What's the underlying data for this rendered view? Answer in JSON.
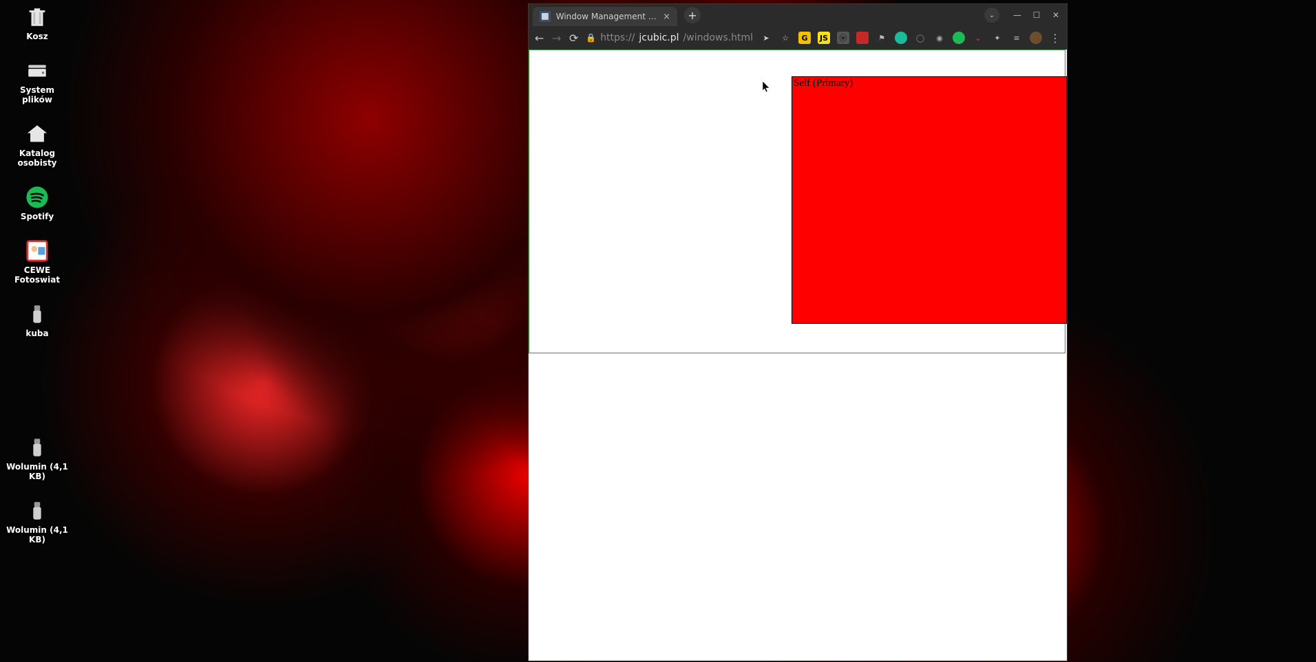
{
  "desktop": {
    "icons": [
      {
        "id": "trash",
        "label": "Kosz"
      },
      {
        "id": "files",
        "label": "System plików"
      },
      {
        "id": "home",
        "label": "Katalog osobisty"
      },
      {
        "id": "spotify",
        "label": "Spotify"
      },
      {
        "id": "cewe",
        "label": "CEWE Fotoswiat"
      },
      {
        "id": "kuba",
        "label": "kuba"
      },
      {
        "id": "vol1",
        "label": "Wolumin (4,1 KB)"
      },
      {
        "id": "vol2",
        "label": "Wolumin (4,1 KB)"
      }
    ]
  },
  "browser": {
    "tab_title": "Window Management Dem",
    "new_tab_label": "+",
    "tab_close_label": "×",
    "window_controls": {
      "dropdown": "⌄",
      "min": "—",
      "max": "☐",
      "close": "✕"
    },
    "nav": {
      "back": "←",
      "forward": "→",
      "reload": "⟳"
    },
    "url": {
      "scheme": "https://",
      "host_dim": "jcubic.pl",
      "path": "/windows.html"
    },
    "extensions": [
      "send",
      "star",
      "yellow",
      "js",
      "gray",
      "red",
      "flag",
      "teal",
      "shield",
      "cam",
      "green",
      "pocket",
      "puzzle",
      "list",
      "avatar",
      "menu"
    ]
  },
  "page": {
    "box_label": "Self (Primary)"
  }
}
